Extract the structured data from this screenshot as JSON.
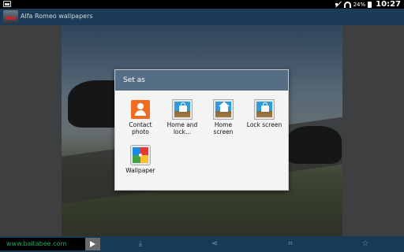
{
  "status_bar": {
    "battery_percent": "24%",
    "time": "10:27",
    "icons": [
      "notification-icon",
      "mute-icon",
      "wifi-icon",
      "battery-icon"
    ]
  },
  "action_bar": {
    "title": "Alfa Romeo wallpapers",
    "icon": "app-icon"
  },
  "dialog": {
    "title": "Set as",
    "options": [
      {
        "label": "Contact photo",
        "icon": "contact-icon"
      },
      {
        "label": "Home and lock...",
        "icon": "home-lock-icon"
      },
      {
        "label": "Home screen",
        "icon": "home-screen-icon"
      },
      {
        "label": "Lock screen",
        "icon": "lock-screen-icon"
      },
      {
        "label": "Wallpaper",
        "icon": "wallpaper-icon"
      }
    ]
  },
  "bottom_bar": {
    "url": "www.baitabee.com",
    "icons": [
      "arrow-icon",
      "download-icon",
      "share-icon",
      "crop-icon",
      "star-icon"
    ]
  },
  "colors": {
    "action_bar": "#1b3b56",
    "dialog_header": "#556e86",
    "url_text": "#1ea860"
  }
}
